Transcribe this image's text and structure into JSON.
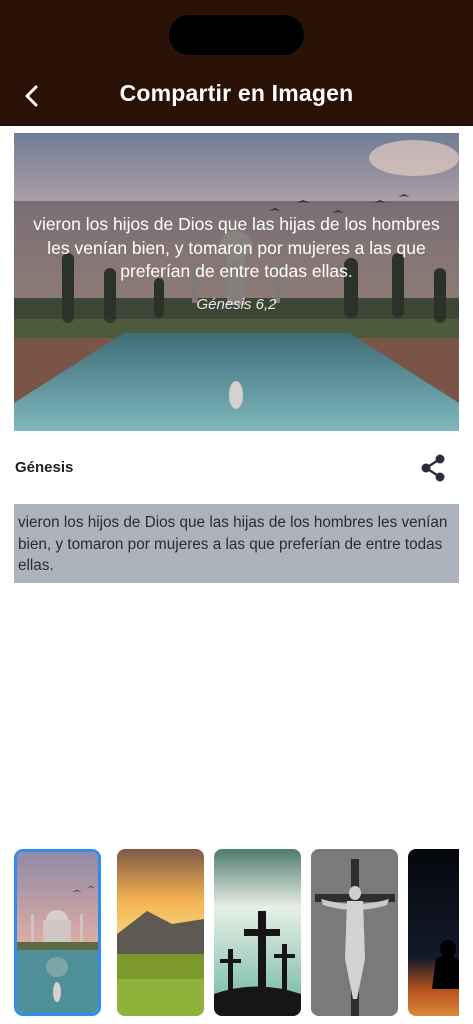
{
  "header": {
    "title": "Compartir en Imagen",
    "back_icon": "chevron-left-icon",
    "background": "#2a1207"
  },
  "preview": {
    "verse_text": "vieron los hijos de Dios que las hijas de los hombres les venían bien, y tomaron por mujeres a las que preferían de entre todas ellas.",
    "reference": "Génesis 6,2"
  },
  "book": {
    "name": "Génesis",
    "share_icon": "share-icon"
  },
  "verse": {
    "text": "vieron los hijos de Dios que las hijas de los hombres les venían bien, y tomaron por mujeres a las que preferían de entre todas ellas."
  },
  "backgrounds": [
    {
      "name": "taj-mahal",
      "selected": true
    },
    {
      "name": "sunset-meadow",
      "selected": false
    },
    {
      "name": "crosses-hill",
      "selected": false
    },
    {
      "name": "crucifix",
      "selected": false
    },
    {
      "name": "silhouette-night",
      "selected": false
    }
  ],
  "colors": {
    "selection_border": "#2f8bec",
    "text_box_bg": "#acb3bd"
  }
}
